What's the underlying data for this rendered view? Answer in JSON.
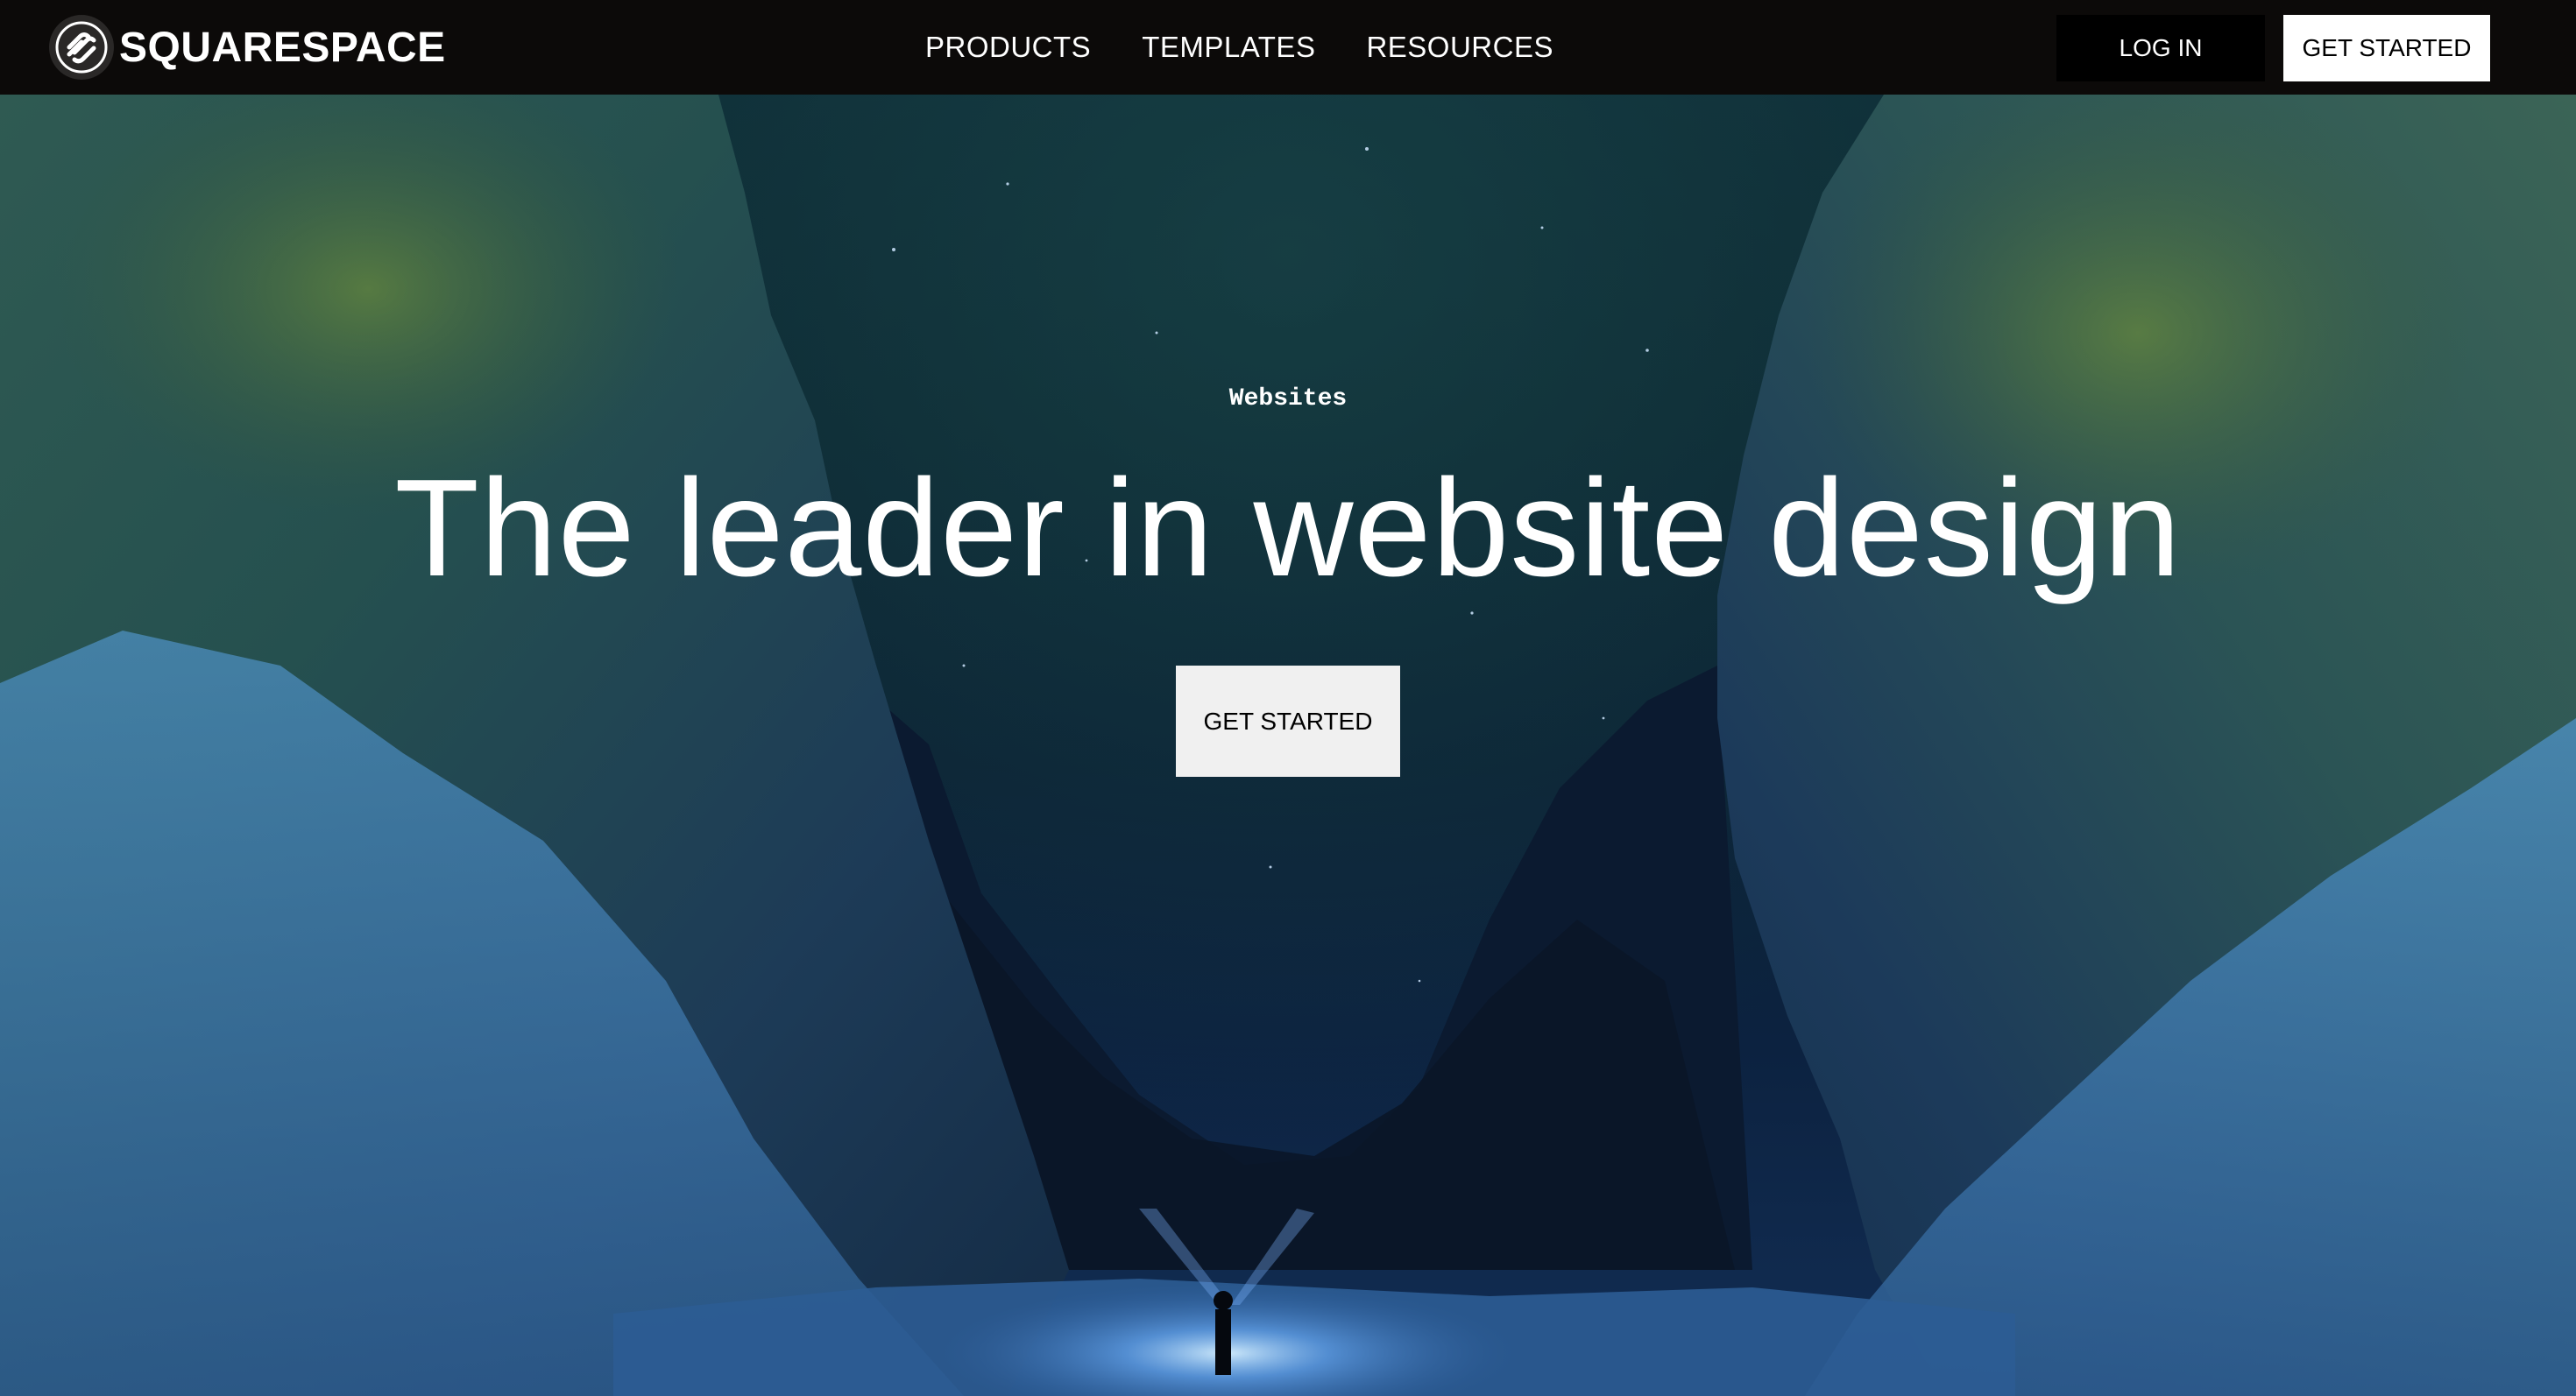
{
  "nav": {
    "brand_name": "SQUARESPACE",
    "brand_icon": "squarespace-logo-icon",
    "links": [
      "PRODUCTS",
      "TEMPLATES",
      "RESOURCES"
    ],
    "login_label": "LOG IN",
    "get_started_label": "GET STARTED"
  },
  "hero": {
    "eyebrow": "Websites",
    "headline": "The leader in website design",
    "cta_label": "GET STARTED",
    "background": "night canyon with snowy cliffs and a lone hiker holding a light"
  },
  "colors": {
    "nav_background": "#0c0a09",
    "login_button": "#000000",
    "get_started_button": "#ffffff",
    "hero_cta_button": "#f0f0f0",
    "text_light": "#ffffff"
  }
}
